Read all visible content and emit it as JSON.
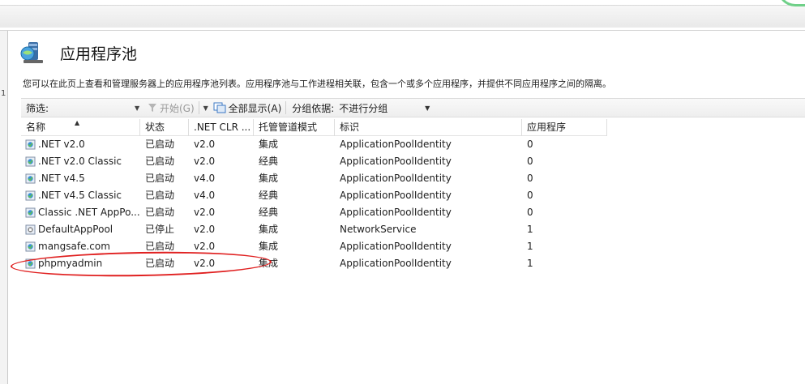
{
  "left_pane": {
    "tick": "1"
  },
  "page": {
    "title": "应用程序池",
    "description": "您可以在此页上查看和管理服务器上的应用程序池列表。应用程序池与工作进程相关联，包含一个或多个应用程序，并提供不同应用程序之间的隔离。"
  },
  "toolbar": {
    "filter_label": "筛选:",
    "start_label": "开始(G)",
    "show_all_label": "全部显示(A)",
    "group_by_label": "分组依据:",
    "group_by_value": "不进行分组"
  },
  "grid": {
    "columns": [
      "名称",
      "状态",
      ".NET CLR ...",
      "托管管道模式",
      "标识",
      "应用程序"
    ],
    "rows": [
      {
        "name": ".NET v2.0",
        "status": "已启动",
        "clr": "v2.0",
        "pipeline": "集成",
        "identity": "ApplicationPoolIdentity",
        "apps": "0",
        "stopped": false
      },
      {
        "name": ".NET v2.0 Classic",
        "status": "已启动",
        "clr": "v2.0",
        "pipeline": "经典",
        "identity": "ApplicationPoolIdentity",
        "apps": "0",
        "stopped": false
      },
      {
        "name": ".NET v4.5",
        "status": "已启动",
        "clr": "v4.0",
        "pipeline": "集成",
        "identity": "ApplicationPoolIdentity",
        "apps": "0",
        "stopped": false
      },
      {
        "name": ".NET v4.5 Classic",
        "status": "已启动",
        "clr": "v4.0",
        "pipeline": "经典",
        "identity": "ApplicationPoolIdentity",
        "apps": "0",
        "stopped": false
      },
      {
        "name": "Classic .NET AppPo...",
        "status": "已启动",
        "clr": "v2.0",
        "pipeline": "经典",
        "identity": "ApplicationPoolIdentity",
        "apps": "0",
        "stopped": false
      },
      {
        "name": "DefaultAppPool",
        "status": "已停止",
        "clr": "v2.0",
        "pipeline": "集成",
        "identity": "NetworkService",
        "apps": "1",
        "stopped": true
      },
      {
        "name": "mangsafe.com",
        "status": "已启动",
        "clr": "v2.0",
        "pipeline": "集成",
        "identity": "ApplicationPoolIdentity",
        "apps": "1",
        "stopped": false
      },
      {
        "name": "phpmyadmin",
        "status": "已启动",
        "clr": "v2.0",
        "pipeline": "集成",
        "identity": "ApplicationPoolIdentity",
        "apps": "1",
        "stopped": false
      }
    ]
  },
  "colors": {
    "annotation": "#e02020",
    "accent_green": "#6fd088"
  }
}
